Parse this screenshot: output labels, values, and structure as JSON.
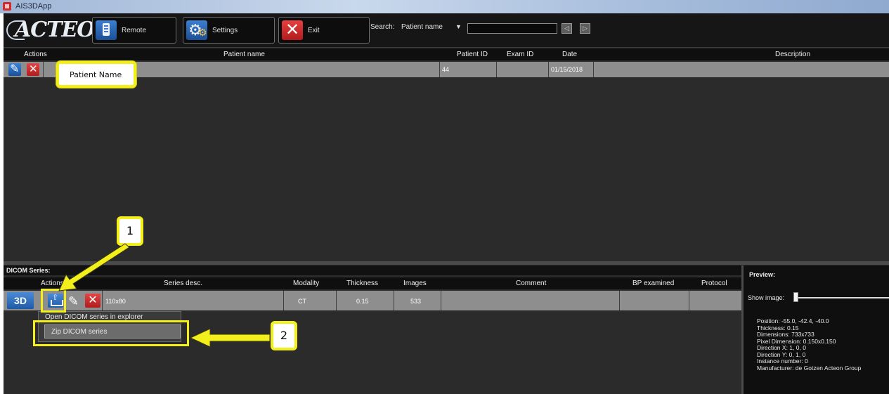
{
  "window": {
    "title": "AIS3DApp"
  },
  "toolbar": {
    "logo": "ACTEON",
    "remote_label": "Remote",
    "settings_label": "Settings",
    "exit_label": "Exit",
    "search_label": "Search:",
    "search_field": "Patient name",
    "search_value": ""
  },
  "patients": {
    "columns": [
      "Actions",
      "Patient name",
      "Patient ID",
      "Exam ID",
      "Date",
      "Description"
    ],
    "rows": [
      {
        "name": "",
        "patient_id": "44",
        "exam_id": "",
        "date": "01/15/2018",
        "description": ""
      }
    ]
  },
  "series": {
    "title": "DICOM Series:",
    "columns": [
      "Actions",
      "Series desc.",
      "Modality",
      "Thickness",
      "Images",
      "Comment",
      "BP examined",
      "Protocol"
    ],
    "rows": [
      {
        "btn_3d": "3D",
        "desc": "110x80",
        "modality": "CT",
        "thickness": "0.15",
        "images": "533",
        "comment": "",
        "bp_examined": "",
        "protocol": ""
      }
    ],
    "context_menu": [
      "Open DICOM series in explorer",
      "Zip DICOM series"
    ]
  },
  "preview": {
    "title": "Preview:",
    "show_image_label": "Show image:",
    "show_image_value": 0,
    "info": [
      "Position: -55.0, -42.4, -40.0",
      "Thickness: 0.15",
      "Dimensions: 733x733",
      "Pixel Dimension: 0.150x0.150",
      "Direction X: 1, 0, 0",
      "Direction Y: 0, 1, 0",
      "Instance number: 0",
      "Manufacturer: de Gotzen Acteon Group"
    ]
  },
  "annotations": {
    "patient_callout": "Patient Name",
    "step1": "1",
    "step2": "2",
    "color": "#f2ef1d"
  },
  "colors": {
    "background": "#2b2b2b",
    "row_selected": "#8e8e8e",
    "header": "#0f0f0f",
    "accent_blue": "#2f6fc0",
    "accent_red": "#c82a2a"
  }
}
